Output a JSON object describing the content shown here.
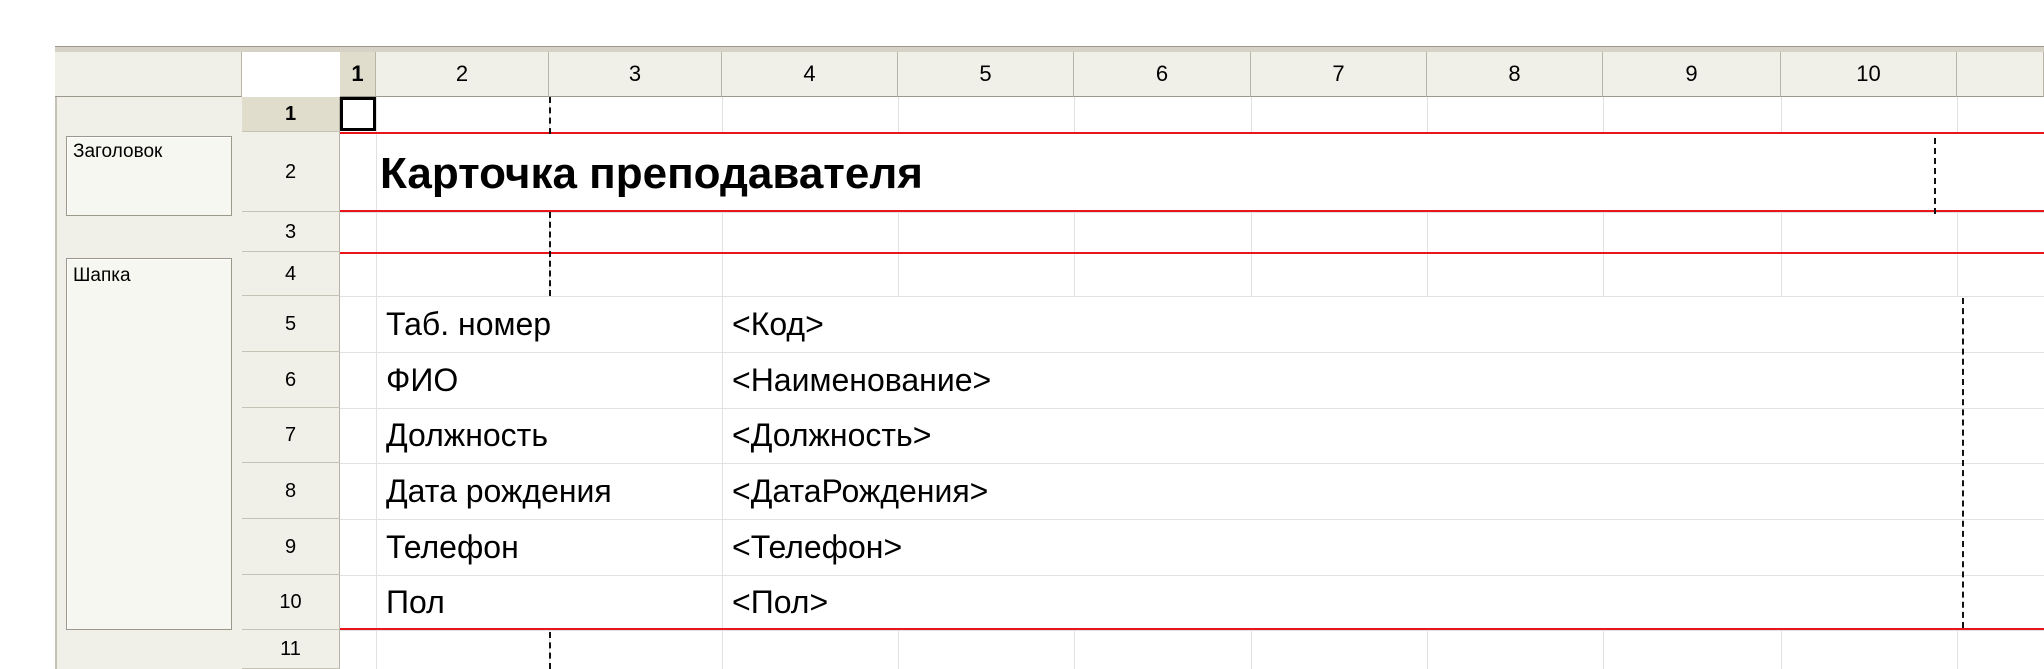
{
  "columns": [
    "1",
    "2",
    "3",
    "4",
    "5",
    "6",
    "7",
    "8",
    "9",
    "10"
  ],
  "rows": [
    "1",
    "2",
    "3",
    "4",
    "5",
    "6",
    "7",
    "8",
    "9",
    "10",
    "11"
  ],
  "row_groups": [
    {
      "label": "Заголовок"
    },
    {
      "label": "Шапка"
    }
  ],
  "title": "Карточка преподавателя",
  "fields": [
    {
      "label": "Таб. номер",
      "value": "<Код>"
    },
    {
      "label": "ФИО",
      "value": "<Наименование>"
    },
    {
      "label": "Должность",
      "value": "<Должность>"
    },
    {
      "label": "Дата рождения",
      "value": "<ДатаРождения>"
    },
    {
      "label": "Телефон",
      "value": "<Телефон>"
    },
    {
      "label": "Пол",
      "value": "<Пол>"
    }
  ],
  "colors": {
    "header_bg": "#f0efe8",
    "active_header_bg": "#e1ddcc",
    "section_line": "#e8161b",
    "grid": "#e2e2e2"
  }
}
